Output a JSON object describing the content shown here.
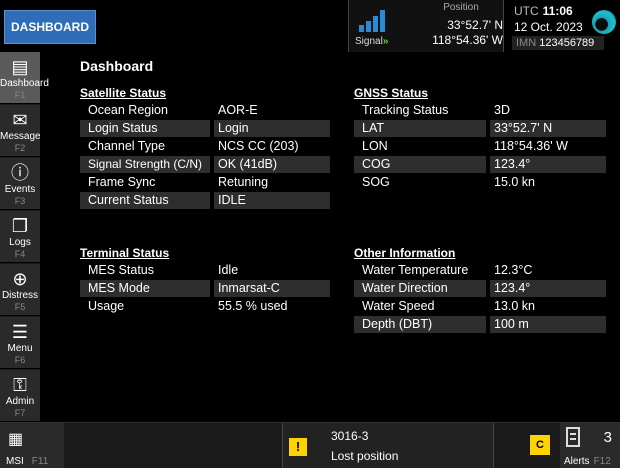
{
  "header": {
    "dashboard_button": "DASHBOARD",
    "signal_label": "Signal",
    "signal_arrows": "»",
    "position_title": "Position",
    "latitude": "33°52.7' N",
    "longitude": "118°54.36' W",
    "utc_label": "UTC",
    "time": "11:06",
    "date": "12 Oct. 2023",
    "imn_label": "IMN",
    "imn_value": "123456789"
  },
  "sidebar": {
    "items": [
      {
        "label": "Dashboard",
        "key": "F1",
        "icon": "dashboard-icon"
      },
      {
        "label": "Message",
        "key": "F2",
        "icon": "mail-icon"
      },
      {
        "label": "Events",
        "key": "F3",
        "icon": "info-icon"
      },
      {
        "label": "Logs",
        "key": "F4",
        "icon": "logs-icon"
      },
      {
        "label": "Distress",
        "key": "F5",
        "icon": "lifebuoy-icon"
      },
      {
        "label": "Menu",
        "key": "F6",
        "icon": "menu-icon"
      },
      {
        "label": "Admin",
        "key": "F7",
        "icon": "admin-icon"
      }
    ]
  },
  "main": {
    "title": "Dashboard",
    "satellite": {
      "heading": "Satellite Status",
      "rows": [
        {
          "k": "Ocean Region",
          "v": "AOR-E"
        },
        {
          "k": "Login Status",
          "v": "Login"
        },
        {
          "k": "Channel Type",
          "v": "NCS CC (203)"
        },
        {
          "k": "Signal Strength (C/N)",
          "v": "OK (41dB)"
        },
        {
          "k": "Frame Sync",
          "v": "Retuning"
        },
        {
          "k": "Current Status",
          "v": "IDLE"
        }
      ]
    },
    "gnss": {
      "heading": "GNSS Status",
      "rows": [
        {
          "k": "Tracking Status",
          "v": "3D"
        },
        {
          "k": "LAT",
          "v": "33°52.7' N"
        },
        {
          "k": "LON",
          "v": "118°54.36' W"
        },
        {
          "k": "COG",
          "v": "123.4°"
        },
        {
          "k": "SOG",
          "v": "15.0 kn"
        }
      ]
    },
    "terminal": {
      "heading": "Terminal Status",
      "rows": [
        {
          "k": "MES Status",
          "v": "Idle"
        },
        {
          "k": "MES Mode",
          "v": "Inmarsat-C"
        },
        {
          "k": "Usage",
          "v": "55.5 % used"
        }
      ]
    },
    "other": {
      "heading": "Other Information",
      "rows": [
        {
          "k": "Water Temperature",
          "v": "12.3°C"
        },
        {
          "k": "Water Direction",
          "v": "123.4°"
        },
        {
          "k": "Water Speed",
          "v": "13.0 kn"
        },
        {
          "k": "Depth (DBT)",
          "v": "100 m"
        }
      ]
    }
  },
  "footer": {
    "msi_label": "MSI",
    "msi_key": "F11",
    "warning_symbol": "!",
    "alert_code": "3016-3",
    "alert_text": "Lost position",
    "category_badge": "C",
    "alerts_count": "3",
    "alerts_label": "Alerts",
    "alerts_key": "F12"
  }
}
